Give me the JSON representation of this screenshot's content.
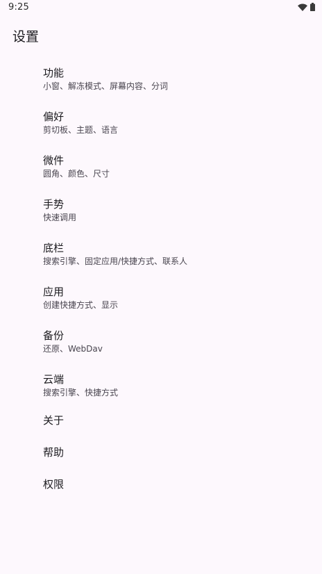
{
  "status_bar": {
    "time": "9:25",
    "icons": [
      "wifi-icon",
      "battery-icon"
    ]
  },
  "page": {
    "title": "设置"
  },
  "settings": {
    "items": [
      {
        "title": "功能",
        "summary": "小窗、解冻模式、屏幕内容、分词"
      },
      {
        "title": "偏好",
        "summary": "剪切板、主题、语言"
      },
      {
        "title": "微件",
        "summary": "圆角、颜色、尺寸"
      },
      {
        "title": "手势",
        "summary": "快速调用"
      },
      {
        "title": "底栏",
        "summary": "搜索引擎、固定应用/快捷方式、联系人"
      },
      {
        "title": "应用",
        "summary": "创建快捷方式、显示"
      },
      {
        "title": "备份",
        "summary": "还原、WebDav"
      },
      {
        "title": "云端",
        "summary": "搜索引擎、快捷方式"
      },
      {
        "title": "关于",
        "summary": ""
      },
      {
        "title": "帮助",
        "summary": ""
      },
      {
        "title": "权限",
        "summary": ""
      }
    ]
  },
  "colors": {
    "background": "#fdf8fd",
    "title_text": "#1c1b1f",
    "summary_text": "#49454f"
  }
}
